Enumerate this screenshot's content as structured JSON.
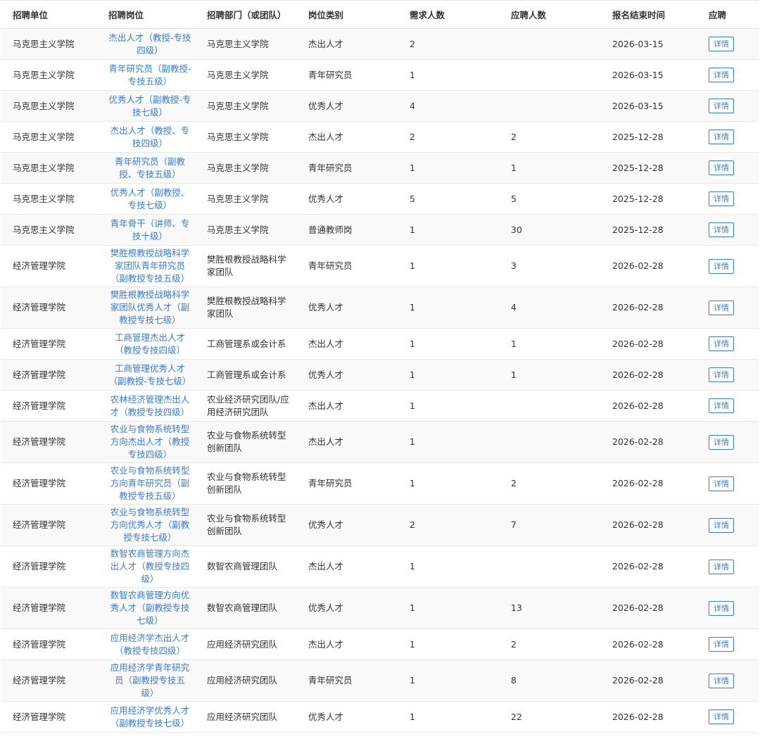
{
  "table": {
    "headers": {
      "unit": "招聘单位",
      "post": "招聘岗位",
      "dept": "招聘部门（或团队）",
      "category": "岗位类别",
      "demand": "需求人数",
      "applicants": "应聘人数",
      "deadline": "报名结束时间",
      "apply": "应聘"
    },
    "rows": [
      {
        "unit": "马克思主义学院",
        "post": [
          "杰出人才（教授-专技",
          "四级）"
        ],
        "dept": [
          "马克思主义学院"
        ],
        "category": "杰出人才",
        "demand": "2",
        "applicants": "",
        "deadline": "2026-03-15",
        "button": "详情"
      },
      {
        "unit": "马克思主义学院",
        "post": [
          "青年研究员（副教授-",
          "专技五级）"
        ],
        "dept": [
          "马克思主义学院"
        ],
        "category": "青年研究员",
        "demand": "1",
        "applicants": "",
        "deadline": "2026-03-15",
        "button": "详情"
      },
      {
        "unit": "马克思主义学院",
        "post": [
          "优秀人才（副教授-专",
          "技七级）"
        ],
        "dept": [
          "马克思主义学院"
        ],
        "category": "优秀人才",
        "demand": "4",
        "applicants": "",
        "deadline": "2026-03-15",
        "button": "详情"
      },
      {
        "unit": "马克思主义学院",
        "post": [
          "杰出人才（教授、专",
          "技四级）"
        ],
        "dept": [
          "马克思主义学院"
        ],
        "category": "杰出人才",
        "demand": "2",
        "applicants": "2",
        "deadline": "2025-12-28",
        "button": "详情"
      },
      {
        "unit": "马克思主义学院",
        "post": [
          "青年研究员（副教",
          "授、专技五级）"
        ],
        "dept": [
          "马克思主义学院"
        ],
        "category": "青年研究员",
        "demand": "1",
        "applicants": "1",
        "deadline": "2025-12-28",
        "button": "详情"
      },
      {
        "unit": "马克思主义学院",
        "post": [
          "优秀人才（副教授、",
          "专技七级）"
        ],
        "dept": [
          "马克思主义学院"
        ],
        "category": "优秀人才",
        "demand": "5",
        "applicants": "5",
        "deadline": "2025-12-28",
        "button": "详情"
      },
      {
        "unit": "马克思主义学院",
        "post": [
          "青年骨干（讲师、专",
          "技十级）"
        ],
        "dept": [
          "马克思主义学院"
        ],
        "category": "普通教师岗",
        "demand": "1",
        "applicants": "30",
        "deadline": "2025-12-28",
        "button": "详情"
      },
      {
        "unit": "经济管理学院",
        "post": [
          "樊胜根教授战略科学",
          "家团队青年研究员",
          "（副教授专技五级）"
        ],
        "dept": [
          "樊胜根教授战略科学",
          "家团队"
        ],
        "category": "青年研究员",
        "demand": "1",
        "applicants": "3",
        "deadline": "2026-02-28",
        "button": "详情"
      },
      {
        "unit": "经济管理学院",
        "post": [
          "樊胜根教授战略科学",
          "家团队优秀人才（副",
          "教授专技七级）"
        ],
        "dept": [
          "樊胜根教授战略科学",
          "家团队"
        ],
        "category": "优秀人才",
        "demand": "1",
        "applicants": "4",
        "deadline": "2026-02-28",
        "button": "详情"
      },
      {
        "unit": "经济管理学院",
        "post": [
          "工商管理杰出人才",
          "（教授专技四级）"
        ],
        "dept": [
          "工商管理系或会计系"
        ],
        "category": "杰出人才",
        "demand": "1",
        "applicants": "1",
        "deadline": "2026-02-28",
        "button": "详情"
      },
      {
        "unit": "经济管理学院",
        "post": [
          "工商管理优秀人才",
          "（副教授-专技七级）"
        ],
        "dept": [
          "工商管理系或会计系"
        ],
        "category": "优秀人才",
        "demand": "1",
        "applicants": "1",
        "deadline": "2026-02-28",
        "button": "详情"
      },
      {
        "unit": "经济管理学院",
        "post": [
          "农林经济管理杰出人",
          "才（教授专技四级）"
        ],
        "dept": [
          "农业经济研究团队/应",
          "用经济研究团队"
        ],
        "category": "杰出人才",
        "demand": "1",
        "applicants": "",
        "deadline": "2026-02-28",
        "button": "详情"
      },
      {
        "unit": "经济管理学院",
        "post": [
          "农业与食物系统转型",
          "方向杰出人才（教授",
          "专技四级）"
        ],
        "dept": [
          "农业与食物系统转型",
          "创新团队"
        ],
        "category": "杰出人才",
        "demand": "1",
        "applicants": "",
        "deadline": "2026-02-28",
        "button": "详情"
      },
      {
        "unit": "经济管理学院",
        "post": [
          "农业与食物系统转型",
          "方向青年研究员（副",
          "教授专技五级）"
        ],
        "dept": [
          "农业与食物系统转型",
          "创新团队"
        ],
        "category": "青年研究员",
        "demand": "1",
        "applicants": "2",
        "deadline": "2026-02-28",
        "button": "详情"
      },
      {
        "unit": "经济管理学院",
        "post": [
          "农业与食物系统转型",
          "方向优秀人才（副教",
          "授专技七级）"
        ],
        "dept": [
          "农业与食物系统转型",
          "创新团队"
        ],
        "category": "优秀人才",
        "demand": "2",
        "applicants": "7",
        "deadline": "2026-02-28",
        "button": "详情"
      },
      {
        "unit": "经济管理学院",
        "post": [
          "数智农商管理方向杰",
          "出人才（教授专技四",
          "级）"
        ],
        "dept": [
          "数智农商管理团队"
        ],
        "category": "杰出人才",
        "demand": "1",
        "applicants": "",
        "deadline": "2026-02-28",
        "button": "详情"
      },
      {
        "unit": "经济管理学院",
        "post": [
          "数智农商管理方向优",
          "秀人才（副教授专技",
          "七级）"
        ],
        "dept": [
          "数智农商管理团队"
        ],
        "category": "优秀人才",
        "demand": "1",
        "applicants": "13",
        "deadline": "2026-02-28",
        "button": "详情"
      },
      {
        "unit": "经济管理学院",
        "post": [
          "应用经济学杰出人才",
          "（教授专技四级）"
        ],
        "dept": [
          "应用经济研究团队"
        ],
        "category": "杰出人才",
        "demand": "1",
        "applicants": "2",
        "deadline": "2026-02-28",
        "button": "详情"
      },
      {
        "unit": "经济管理学院",
        "post": [
          "应用经济学青年研究",
          "员（副教授专技五",
          "级）"
        ],
        "dept": [
          "应用经济研究团队"
        ],
        "category": "青年研究员",
        "demand": "1",
        "applicants": "8",
        "deadline": "2026-02-28",
        "button": "详情"
      },
      {
        "unit": "经济管理学院",
        "post": [
          "应用经济学优秀人才",
          "（副教授专技七级）"
        ],
        "dept": [
          "应用经济研究团队"
        ],
        "category": "优秀人才",
        "demand": "1",
        "applicants": "22",
        "deadline": "2026-02-28",
        "button": "详情"
      }
    ]
  }
}
